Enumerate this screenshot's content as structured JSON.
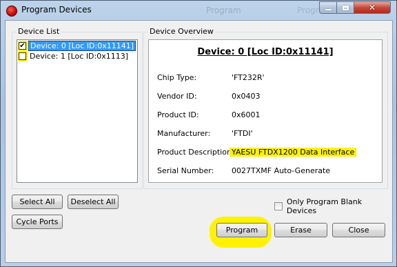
{
  "window": {
    "title": "Program Devices",
    "background_ghost_text_1": "Program",
    "background_ghost_text_2": "Program"
  },
  "device_list": {
    "title": "Device List",
    "items": [
      {
        "label": "Device: 0 [Loc ID:0x11141]",
        "checked": true,
        "selected": true
      },
      {
        "label": "Device: 1 [Loc ID:0x1113]",
        "checked": false,
        "selected": false
      }
    ]
  },
  "overview": {
    "title": "Device Overview",
    "heading": "Device: 0 [Loc ID:0x11141]",
    "fields": [
      {
        "label": "Chip Type:",
        "value": "'FT232R'"
      },
      {
        "label": "Vendor ID:",
        "value": "0x0403"
      },
      {
        "label": "Product ID:",
        "value": "0x6001"
      },
      {
        "label": "Manufacturer:",
        "value": "'FTDI'"
      },
      {
        "label": "Product Description:",
        "value": "YAESU FTDX1200 Data Interface"
      },
      {
        "label": "Serial Number:",
        "value": "0027TXMF Auto-Generate"
      }
    ]
  },
  "buttons": {
    "select_all": "Select All",
    "deselect_all": "Deselect All",
    "cycle_ports": "Cycle Ports",
    "program": "Program",
    "erase": "Erase",
    "close": "Close"
  },
  "options": {
    "only_program_blank": "Only Program Blank Devices",
    "only_program_blank_checked": false
  },
  "colors": {
    "highlight": "#fff200",
    "selection": "#3399ff"
  }
}
